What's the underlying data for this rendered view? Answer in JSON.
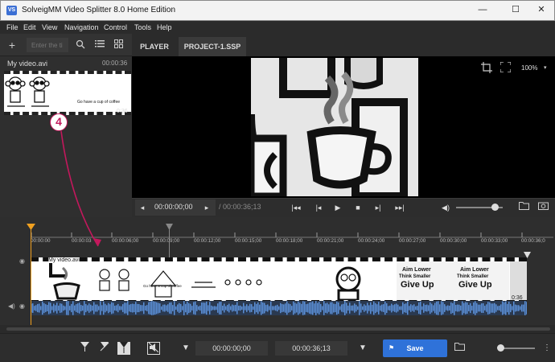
{
  "window": {
    "app_icon_text": "VS",
    "title": "SolveigMM Video Splitter 8.0 Home Edition",
    "minimize_glyph": "—",
    "maximize_glyph": "☐",
    "close_glyph": "✕"
  },
  "menu": [
    "File",
    "Edit",
    "View",
    "Navigation",
    "Control",
    "Tools",
    "Help"
  ],
  "left_panel": {
    "search_placeholder": "Enter the ti",
    "file_name": "My video.avi",
    "file_duration": "00:00:36",
    "thumb_caption": "Go have a cup of coffee",
    "thumb_duration": "0:36"
  },
  "tabs": [
    "PLAYER",
    "PROJECT-1.SSP"
  ],
  "player": {
    "zoom": "100%",
    "time_current": "00:00:00;00",
    "time_total": "/ 00:00:36;13",
    "volume_level": 0.82
  },
  "timeline": {
    "ticks": [
      "00:00:00",
      "00:00:03",
      "00:00:06;00",
      "00:00:09;00",
      "00:00:12;00",
      "00:00:15;00",
      "00:00:18;00",
      "00:00:21;00",
      "00:00:24;00",
      "00:00:27;00",
      "00:00:30;00",
      "00:00:33;00",
      "00:00:36;0"
    ],
    "video_track_label": "My video.avi",
    "video_track_duration": "0:36",
    "frame_texts": [
      "Go have a cup of coffee",
      "Aim Lower",
      "Think Smaller",
      "Give Up"
    ]
  },
  "bottom_bar": {
    "start_time": "00:00:00;00",
    "end_time": "00:00:36;13",
    "save_label": "Save"
  },
  "annotation": {
    "number": "4",
    "color": "#c3185c"
  },
  "colors": {
    "accent": "#2f72d9",
    "playhead": "#f0a020",
    "audio_wave": "#5b8fd6"
  }
}
